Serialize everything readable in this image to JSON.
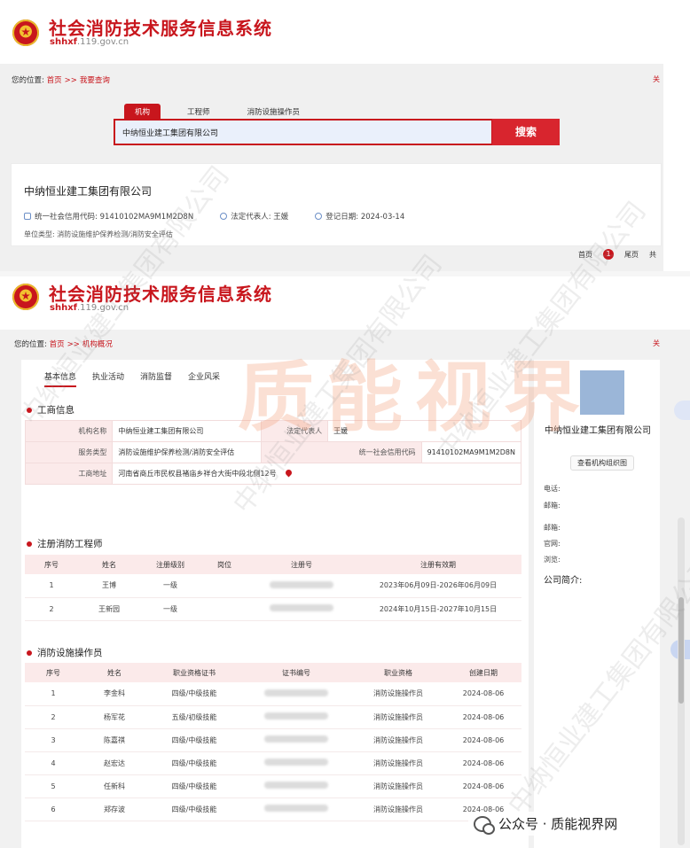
{
  "header": {
    "title": "社会消防技术服务信息系统",
    "domain_prefix": "shhxf",
    "domain_suffix": ".119.gov.cn"
  },
  "search_page": {
    "breadcrumb": {
      "label": "您的位置:",
      "home": "首页",
      "sep": ">>",
      "current": "我要查询"
    },
    "edge_text": "关",
    "tabs": [
      "机构",
      "工程师",
      "消防设施操作员"
    ],
    "active_tab": "机构",
    "search_value": "中纳恒业建工集团有限公司",
    "search_button": "搜索",
    "result": {
      "name": "中纳恒业建工集团有限公司",
      "credit_code": "统一社会信用代码: 91410102MA9M1M2D8N",
      "legal_rep": "法定代表人: 王媛",
      "reg_date": "登记日期: 2024-03-14",
      "unit_type": "单位类型: 消防设施维护保养检测/消防安全评估"
    },
    "pager": {
      "first": "首页",
      "current": "1",
      "last": "尾页",
      "total": "共"
    }
  },
  "detail_page": {
    "breadcrumb": {
      "label": "您的位置:",
      "home": "首页",
      "sep": ">>",
      "current": "机构概况"
    },
    "edge_text": "关",
    "tabs": [
      "基本信息",
      "执业活动",
      "消防监督",
      "企业风采"
    ],
    "active_tab": "基本信息",
    "business": {
      "title": "工商信息",
      "org_name_label": "机构名称",
      "org_name": "中纳恒业建工集团有限公司",
      "legal_label": "法定代表人",
      "legal": "王媛",
      "service_label": "服务类型",
      "service": "消防设施维护保养检测/消防安全评估",
      "credit_label": "统一社会信用代码",
      "credit": "91410102MA9M1M2D8N",
      "address_label": "工商地址",
      "address": "河南省商丘市民权县褚庙乡祥合大街中段北侧12号"
    },
    "engineers": {
      "title": "注册消防工程师",
      "columns": [
        "序号",
        "姓名",
        "注册级别",
        "岗位",
        "注册号",
        "注册有效期"
      ],
      "rows": [
        {
          "no": "1",
          "name": "王博",
          "level": "一级",
          "post": "",
          "validity": "2023年06月09日-2026年06月09日"
        },
        {
          "no": "2",
          "name": "王新园",
          "level": "一级",
          "post": "",
          "validity": "2024年10月15日-2027年10月15日"
        }
      ]
    },
    "operators": {
      "title": "消防设施操作员",
      "columns": [
        "序号",
        "姓名",
        "职业资格证书",
        "证书编号",
        "职业资格",
        "创建日期"
      ],
      "rows": [
        {
          "no": "1",
          "name": "李金科",
          "cert": "四级/中级技能",
          "qual": "消防设施操作员",
          "date": "2024-08-06"
        },
        {
          "no": "2",
          "name": "杨军花",
          "cert": "五级/初级技能",
          "qual": "消防设施操作员",
          "date": "2024-08-06"
        },
        {
          "no": "3",
          "name": "陈嘉祺",
          "cert": "四级/中级技能",
          "qual": "消防设施操作员",
          "date": "2024-08-06"
        },
        {
          "no": "4",
          "name": "赵宏达",
          "cert": "四级/中级技能",
          "qual": "消防设施操作员",
          "date": "2024-08-06"
        },
        {
          "no": "5",
          "name": "任新科",
          "cert": "四级/中级技能",
          "qual": "消防设施操作员",
          "date": "2024-08-06"
        },
        {
          "no": "6",
          "name": "郑存波",
          "cert": "四级/中级技能",
          "qual": "消防设施操作员",
          "date": "2024-08-06"
        }
      ]
    },
    "sidebar": {
      "company_name": "中纳恒业建工集团有限公司",
      "org_chart_button": "查看机构组织图",
      "phone_label": "电话:",
      "postcode_label": "邮箱:",
      "email_label": "邮箱:",
      "website_label": "官网:",
      "views_label": "浏览:",
      "intro_label": "公司简介:"
    }
  },
  "overlay": {
    "big_watermark": "质能视界",
    "diag_watermark": "中纳恒业建工集团有限公司",
    "wechat": "公众号 · 质能视界网"
  },
  "colors": {
    "brand_red": "#c8161d",
    "header_bg": "#fbeaea",
    "panel_grey": "#f1f1f1"
  }
}
